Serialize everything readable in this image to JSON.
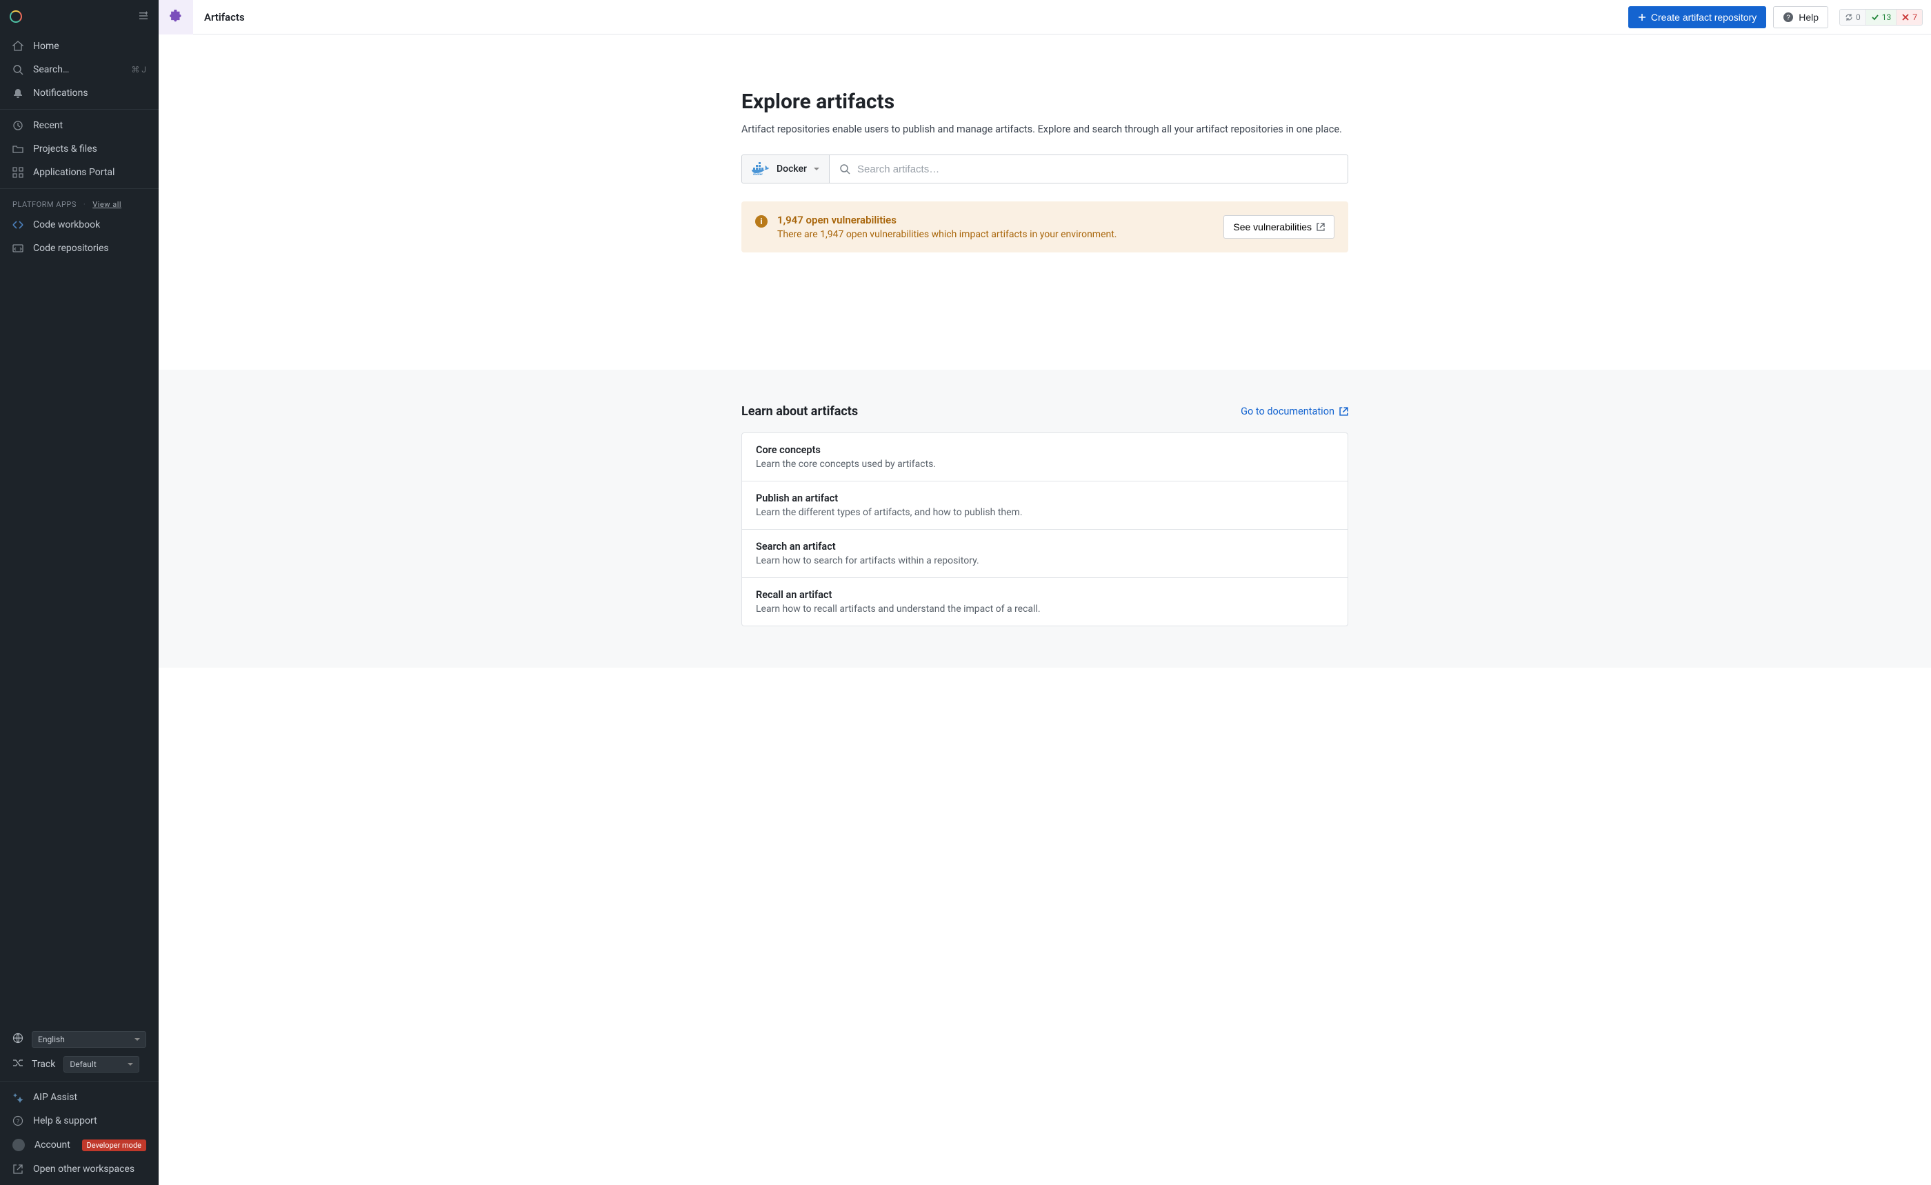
{
  "sidebar": {
    "nav": {
      "home": "Home",
      "search": "Search…",
      "search_kbd": "⌘ J",
      "notifications": "Notifications",
      "recent": "Recent",
      "projects": "Projects & files",
      "apps_portal": "Applications Portal"
    },
    "platform_header": "PLATFORM APPS",
    "platform_viewall": "View all",
    "platform_items": {
      "workbook": "Code workbook",
      "repos": "Code repositories"
    },
    "language_label": "English",
    "track_label": "Track",
    "track_value": "Default",
    "aip": "AIP Assist",
    "help": "Help & support",
    "account": "Account",
    "dev_badge": "Developer mode",
    "open_workspaces": "Open other workspaces"
  },
  "topbar": {
    "app_title": "Artifacts",
    "create_btn": "Create artifact repository",
    "help_btn": "Help",
    "status": {
      "sync": "0",
      "ok": "13",
      "err": "7"
    }
  },
  "page": {
    "title": "Explore artifacts",
    "subtitle": "Artifact repositories enable users to publish and manage artifacts. Explore and search through all your artifact repositories in one place.",
    "search_type": "Docker",
    "search_placeholder": "Search artifacts…"
  },
  "alert": {
    "title": "1,947 open vulnerabilities",
    "desc": "There are 1,947 open vulnerabilities which impact artifacts in your environment.",
    "btn": "See vulnerabilities"
  },
  "learn": {
    "title": "Learn about artifacts",
    "link": "Go to documentation",
    "items": [
      {
        "title": "Core concepts",
        "desc": "Learn the core concepts used by artifacts."
      },
      {
        "title": "Publish an artifact",
        "desc": "Learn the different types of artifacts, and how to publish them."
      },
      {
        "title": "Search an artifact",
        "desc": "Learn how to search for artifacts within a repository."
      },
      {
        "title": "Recall an artifact",
        "desc": "Learn how to recall artifacts and understand the impact of a recall."
      }
    ]
  }
}
